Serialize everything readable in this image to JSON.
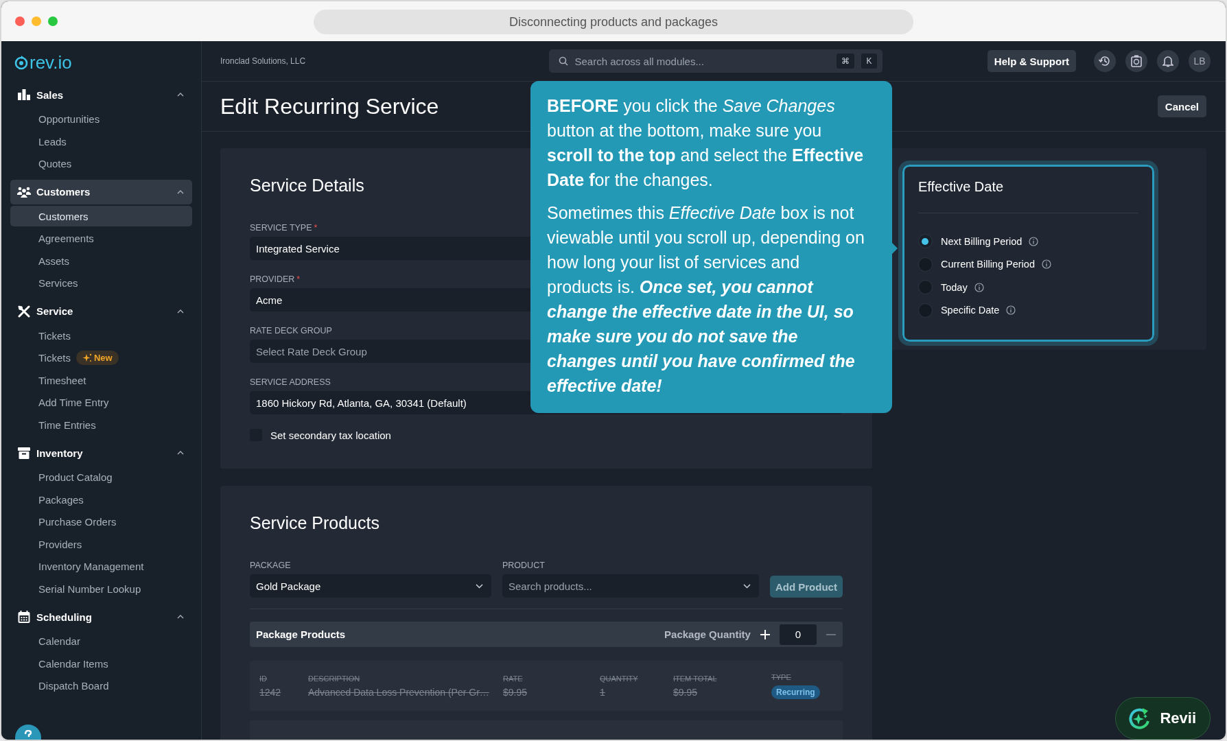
{
  "window": {
    "title": "Disconnecting products and packages"
  },
  "sidebar": {
    "logo": "rev.io",
    "groups": [
      {
        "label": "Sales",
        "selected": false,
        "expanded": true,
        "items": [
          {
            "label": "Opportunities",
            "selected": false
          },
          {
            "label": "Leads",
            "selected": false
          },
          {
            "label": "Quotes",
            "selected": false
          }
        ]
      },
      {
        "label": "Customers",
        "selected": true,
        "expanded": true,
        "items": [
          {
            "label": "Customers",
            "selected": true
          },
          {
            "label": "Agreements",
            "selected": false
          },
          {
            "label": "Assets",
            "selected": false
          },
          {
            "label": "Services",
            "selected": false
          }
        ]
      },
      {
        "label": "Service",
        "selected": false,
        "expanded": true,
        "items": [
          {
            "label": "Tickets",
            "selected": false
          },
          {
            "label": "Tickets",
            "selected": false,
            "badge": "New"
          },
          {
            "label": "Timesheet",
            "selected": false
          },
          {
            "label": "Add Time Entry",
            "selected": false
          },
          {
            "label": "Time Entries",
            "selected": false
          }
        ]
      },
      {
        "label": "Inventory",
        "selected": false,
        "expanded": true,
        "items": [
          {
            "label": "Product Catalog",
            "selected": false
          },
          {
            "label": "Packages",
            "selected": false
          },
          {
            "label": "Purchase Orders",
            "selected": false
          },
          {
            "label": "Providers",
            "selected": false
          },
          {
            "label": "Inventory Management",
            "selected": false
          },
          {
            "label": "Serial Number Lookup",
            "selected": false
          }
        ]
      },
      {
        "label": "Scheduling",
        "selected": false,
        "expanded": true,
        "items": [
          {
            "label": "Calendar",
            "selected": false
          },
          {
            "label": "Calendar Items",
            "selected": false
          },
          {
            "label": "Dispatch Board",
            "selected": false
          }
        ]
      }
    ]
  },
  "topbar": {
    "company": "Ironclad Solutions, LLC",
    "search_placeholder": "Search across all modules...",
    "shortcut_keys": [
      "⌘",
      "K"
    ],
    "help": "Help & Support",
    "avatar": "LB"
  },
  "header": {
    "title": "Edit Recurring Service",
    "cancel": "Cancel"
  },
  "service_details": {
    "title": "Service Details",
    "fields": [
      {
        "label": "SERVICE TYPE",
        "required_mark": "*",
        "value": "Integrated Service"
      },
      {
        "label": "PROVIDER",
        "required_mark": "*",
        "value": "Acme"
      },
      {
        "label": "RATE DECK GROUP",
        "placeholder": "Select Rate Deck Group"
      },
      {
        "label": "SERVICE ADDRESS",
        "value": "1860 Hickory Rd, Atlanta, GA, 30341 (Default)"
      }
    ],
    "checkbox": {
      "label": "Set secondary tax location",
      "checked": false
    }
  },
  "callout": {
    "paragraphs": [
      "**BEFORE** you click the *Save Changes* button at the bottom, make sure you **scroll to the top** and select the **Effective Date f**or the changes.",
      "Sometimes this *Effective Date* box is not viewable until you scroll up, depending on how long your list of services and products is. **Once set, you cannot change the effective date in the UI, so make sure you do not save the changes until you have confirmed the effective date!**"
    ]
  },
  "effective_date": {
    "title": "Effective Date",
    "options": [
      {
        "label": "Next Billing Period",
        "selected": true
      },
      {
        "label": "Current Billing Period",
        "selected": false
      },
      {
        "label": "Today",
        "selected": false
      },
      {
        "label": "Specific Date",
        "selected": false
      }
    ]
  },
  "service_products": {
    "title": "Service Products",
    "package": {
      "label": "PACKAGE",
      "value": "Gold Package"
    },
    "product": {
      "label": "PRODUCT",
      "placeholder": "Search products..."
    },
    "add_button": {
      "label": "Add Product",
      "disabled": true
    },
    "package_products": {
      "title": "Package Products",
      "quantity_label": "Package Quantity",
      "quantity": "0",
      "columns": [
        "ID",
        "DESCRIPTION",
        "RATE",
        "QUANTITY",
        "ITEM TOTAL",
        "TYPE"
      ],
      "rows": [
        {
          "removed": true,
          "cells": [
            "1242",
            "Advanced Data Loss Prevention (Per Gr…",
            "$9.95",
            "1",
            "$9.95"
          ],
          "type": "Recurring"
        }
      ]
    }
  },
  "assistant": {
    "label": "Revii"
  }
}
